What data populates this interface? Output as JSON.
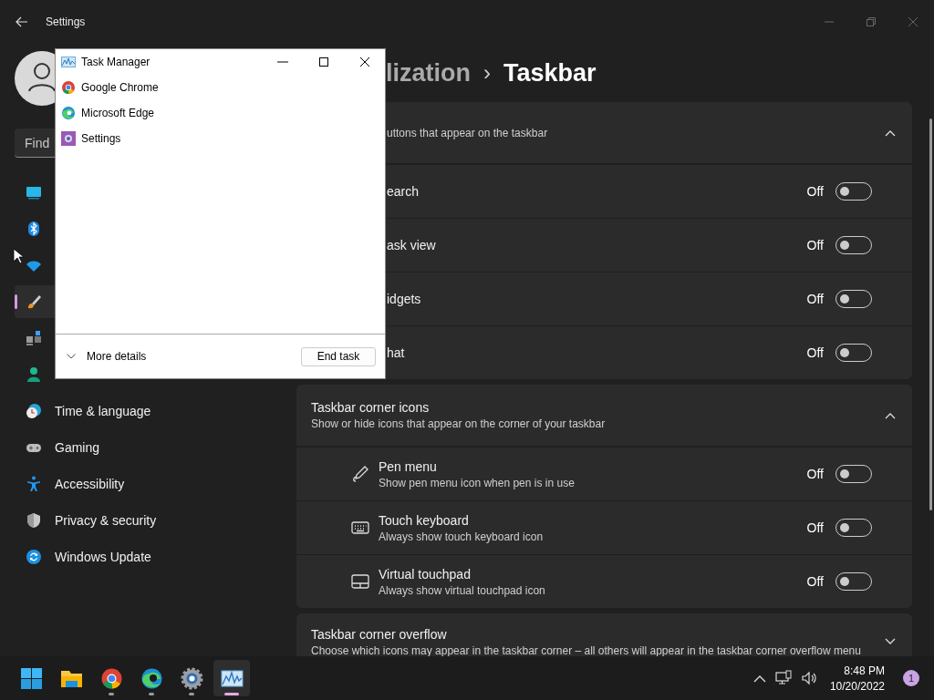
{
  "window": {
    "title": "Settings"
  },
  "search": {
    "placeholder": "Find"
  },
  "sidebar": {
    "items": [
      {
        "selected": false
      },
      {
        "selected": false
      },
      {
        "selected": false
      },
      {
        "selected": true
      },
      {
        "selected": false
      },
      {
        "selected": false
      },
      {
        "label": "Time & language",
        "selected": false
      },
      {
        "label": "Gaming",
        "selected": false
      },
      {
        "label": "Accessibility",
        "selected": false
      },
      {
        "label": "Privacy & security",
        "selected": false
      },
      {
        "label": "Windows Update",
        "selected": false
      }
    ]
  },
  "breadcrumb": {
    "parent": "lization",
    "separator": "›",
    "current": "Taskbar"
  },
  "sections": [
    {
      "subtitle": "uttons that appear on the taskbar",
      "expanded": true,
      "rows": [
        {
          "label": "earch",
          "state": "Off",
          "on": false
        },
        {
          "label": "ask view",
          "state": "Off",
          "on": false
        },
        {
          "label": "idgets",
          "state": "Off",
          "on": false
        },
        {
          "label": "hat",
          "state": "Off",
          "on": false
        }
      ]
    },
    {
      "title": "Taskbar corner icons",
      "subtitle": "Show or hide icons that appear on the corner of your taskbar",
      "expanded": true,
      "rows": [
        {
          "label": "Pen menu",
          "description": "Show pen menu icon when pen is in use",
          "state": "Off",
          "on": false
        },
        {
          "label": "Touch keyboard",
          "description": "Always show touch keyboard icon",
          "state": "Off",
          "on": false
        },
        {
          "label": "Virtual touchpad",
          "description": "Always show virtual touchpad icon",
          "state": "Off",
          "on": false
        }
      ]
    },
    {
      "title": "Taskbar corner overflow",
      "subtitle": "Choose which icons may appear in the taskbar corner – all others will appear in the taskbar corner overflow menu",
      "expanded": false
    }
  ],
  "task_manager": {
    "title": "Task Manager",
    "apps": [
      {
        "name": "Google Chrome"
      },
      {
        "name": "Microsoft Edge"
      },
      {
        "name": "Settings"
      }
    ],
    "more_details": "More details",
    "end_task": "End task"
  },
  "taskbar": {
    "apps": [
      {
        "running": false,
        "active": false
      },
      {
        "running": false,
        "active": false
      },
      {
        "running": true,
        "active": false
      },
      {
        "running": true,
        "active": false
      },
      {
        "running": true,
        "active": false
      },
      {
        "running": true,
        "active": true
      }
    ],
    "time": "8:48 PM",
    "date": "10/20/2022",
    "notifications": "1"
  }
}
